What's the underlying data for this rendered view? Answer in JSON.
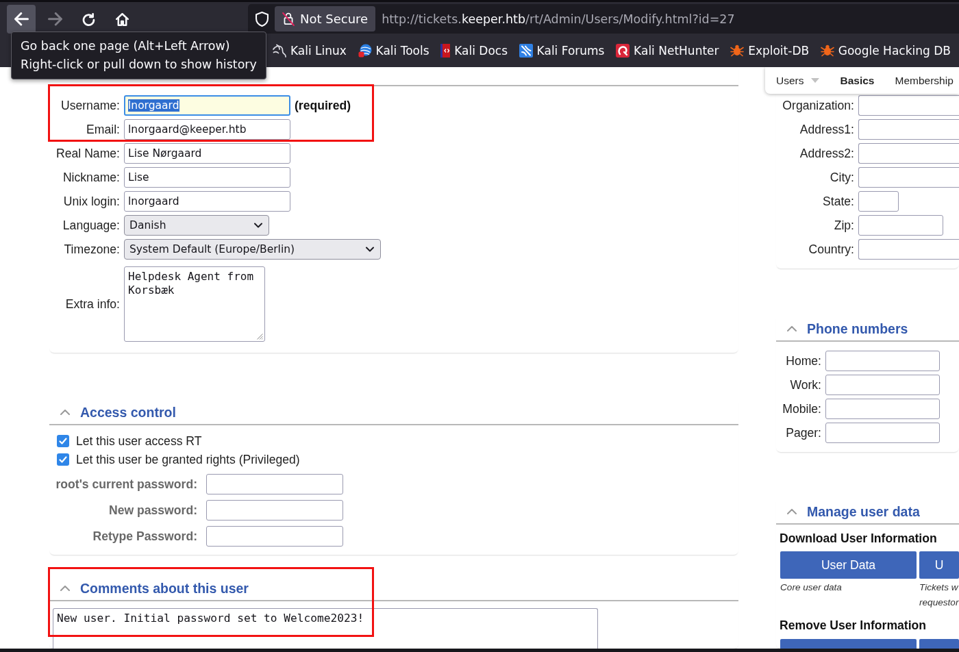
{
  "browser": {
    "nav_buttons": [
      {
        "kind": "back",
        "hovered": true,
        "disabled": false
      },
      {
        "kind": "forward",
        "hovered": false,
        "disabled": true
      },
      {
        "kind": "reload",
        "hovered": false,
        "disabled": false
      },
      {
        "kind": "home",
        "hovered": false,
        "disabled": false
      }
    ],
    "security_label": "Not Secure",
    "url": "http://tickets.**keeper.htb**/rt/Admin/Users/Modify.html?id=27",
    "bookmarks": [
      {
        "label": "Kali Linux",
        "kind": "dragon"
      },
      {
        "label": "Kali Tools",
        "kind": "globe"
      },
      {
        "label": "Kali Docs",
        "kind": "document"
      },
      {
        "label": "Kali Forums",
        "kind": "tile"
      },
      {
        "label": "Kali NetHunter",
        "kind": "hook"
      },
      {
        "label": "Exploit-DB",
        "kind": "bug"
      },
      {
        "label": "Google Hacking DB",
        "kind": "bug"
      }
    ],
    "tooltip": {
      "lines": [
        "Go back one page (Alt+Left Arrow)",
        "Right-click or pull down to show history"
      ]
    }
  },
  "page_menu": [
    {
      "label": "Users",
      "dropdown": true,
      "selected": false
    },
    {
      "label": "Basics",
      "dropdown": false,
      "selected": true
    },
    {
      "label": "Membership",
      "dropdown": false,
      "selected": false
    }
  ],
  "identity": {
    "fields": [
      {
        "label": "Username:",
        "kind": "text",
        "value": "lnorgaard",
        "focused": true,
        "highlighted": true,
        "note": "(required)"
      },
      {
        "label": "Email:",
        "kind": "text",
        "value": "lnorgaard@keeper.htb",
        "focused": false,
        "highlighted": true
      },
      {
        "label": "Real Name:",
        "kind": "text",
        "value": "Lise Nørgaard",
        "focused": false,
        "highlighted": false
      },
      {
        "label": "Nickname:",
        "kind": "text",
        "value": "Lise",
        "focused": false,
        "highlighted": false
      },
      {
        "label": "Unix login:",
        "kind": "text",
        "value": "lnorgaard",
        "focused": false,
        "highlighted": false
      },
      {
        "label": "Language:",
        "kind": "select",
        "value": "Danish",
        "focused": false,
        "highlighted": false
      },
      {
        "label": "Timezone:",
        "kind": "select",
        "value": "System Default (Europe/Berlin)",
        "focused": false,
        "highlighted": false
      },
      {
        "label": "Extra info:",
        "kind": "textarea",
        "value": "Helpdesk Agent from Korsbæk",
        "focused": false,
        "highlighted": false
      }
    ]
  },
  "access_control": {
    "title": "Access control",
    "expanded": true,
    "checkboxes": [
      {
        "label": "Let this user access RT",
        "checked": true
      },
      {
        "label": "Let this user be granted rights (Privileged)",
        "checked": true
      }
    ],
    "password_fields": [
      {
        "label": "root's current password:"
      },
      {
        "label": "New password:"
      },
      {
        "label": "Retype Password:"
      }
    ]
  },
  "comments": {
    "title": "Comments about this user",
    "expanded": true,
    "highlighted": true,
    "value": "New user. Initial password set to Welcome2023!"
  },
  "address": {
    "fields": [
      {
        "label": "Organization:"
      },
      {
        "label": "Address1:"
      },
      {
        "label": "Address2:"
      },
      {
        "label": "City:"
      },
      {
        "label": "State:"
      },
      {
        "label": "Zip:"
      },
      {
        "label": "Country:"
      }
    ]
  },
  "phone_numbers": {
    "title": "Phone numbers",
    "expanded": true,
    "fields": [
      {
        "label": "Home:"
      },
      {
        "label": "Work:"
      },
      {
        "label": "Mobile:"
      },
      {
        "label": "Pager:"
      }
    ]
  },
  "manage_user_data": {
    "title": "Manage user data",
    "expanded": true,
    "groups": [
      {
        "title": "Download User Information",
        "buttons": [
          {
            "kind": "button",
            "label": "User Data",
            "description": [
              "Core user data"
            ]
          },
          {
            "kind": "button",
            "label": "U",
            "description": [
              "Tickets w",
              "requestor"
            ]
          }
        ]
      },
      {
        "title": "Remove User Information",
        "buttons": [
          {
            "kind": "button"
          },
          {
            "kind": "button"
          }
        ]
      }
    ]
  }
}
